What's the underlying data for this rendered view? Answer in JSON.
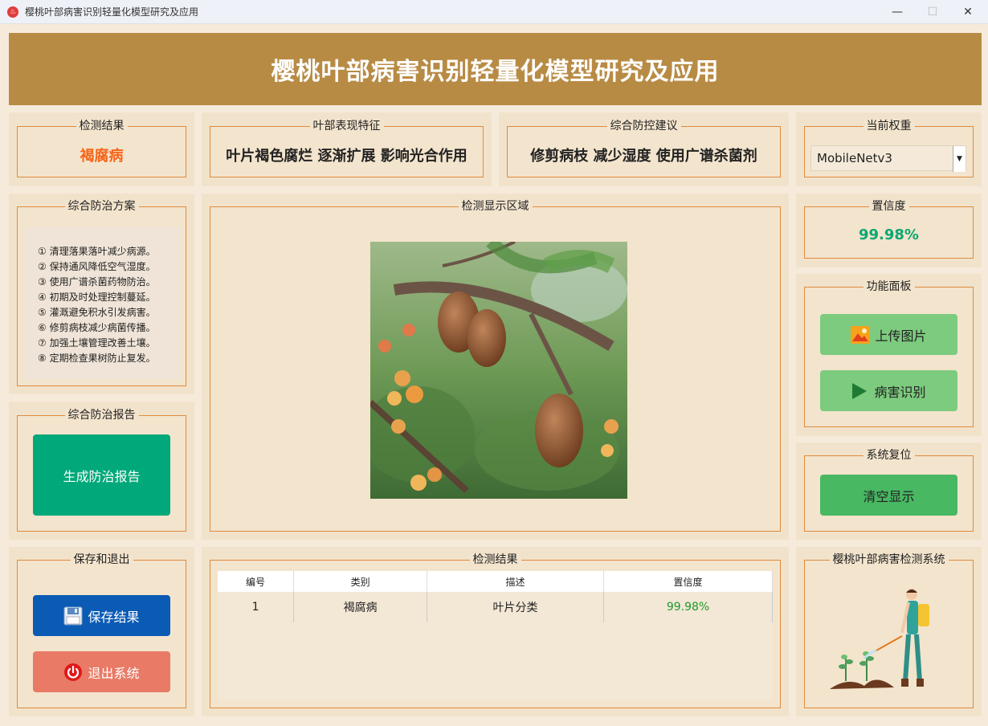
{
  "window": {
    "title": "樱桃叶部病害识别轻量化模型研究及应用",
    "app_icon": "cherry-icon"
  },
  "header": {
    "title": "樱桃叶部病害识别轻量化模型研究及应用"
  },
  "detect_result": {
    "legend": "检测结果",
    "value": "褐腐病",
    "color": "#f5651a"
  },
  "leaf_features": {
    "legend": "叶部表现特征",
    "value": "叶片褐色腐烂 逐渐扩展 影响光合作用"
  },
  "control_advice": {
    "legend": "综合防控建议",
    "value": "修剪病枝 减少湿度 使用广谱杀菌剂"
  },
  "weights": {
    "legend": "当前权重",
    "selected": "MobileNetv3"
  },
  "plan": {
    "legend": "综合防治方案",
    "items": [
      "① 清理落果落叶减少病源。",
      "② 保持通风降低空气湿度。",
      "③ 使用广谱杀菌药物防治。",
      "④ 初期及时处理控制蔓延。",
      "⑤ 灌溉避免积水引发病害。",
      "⑥ 修剪病枝减少病菌传播。",
      "⑦ 加强土壤管理改善土壤。",
      "⑧ 定期检查果树防止复发。"
    ]
  },
  "report": {
    "legend": "综合防治报告",
    "button": "生成防治报告",
    "color": "#00a87a"
  },
  "display": {
    "legend": "检测显示区域"
  },
  "confidence": {
    "legend": "置信度",
    "value": "99.98%",
    "color": "#0aa870"
  },
  "functions": {
    "legend": "功能面板",
    "upload": "上传图片",
    "identify": "病害识别",
    "color": "#7ccb7e"
  },
  "reset": {
    "legend": "系统复位",
    "clear": "清空显示",
    "color": "#48b862"
  },
  "save_exit": {
    "legend": "保存和退出",
    "save": "保存结果",
    "exit": "退出系统",
    "save_color": "#0b5bb5",
    "exit_color": "#e87a66"
  },
  "results_table": {
    "legend": "检测结果",
    "columns": [
      "编号",
      "类别",
      "描述",
      "置信度"
    ],
    "rows": [
      {
        "id": "1",
        "category": "褐腐病",
        "desc": "叶片分类",
        "conf": "99.98%"
      }
    ]
  },
  "system": {
    "legend": "樱桃叶部病害检测系统"
  }
}
